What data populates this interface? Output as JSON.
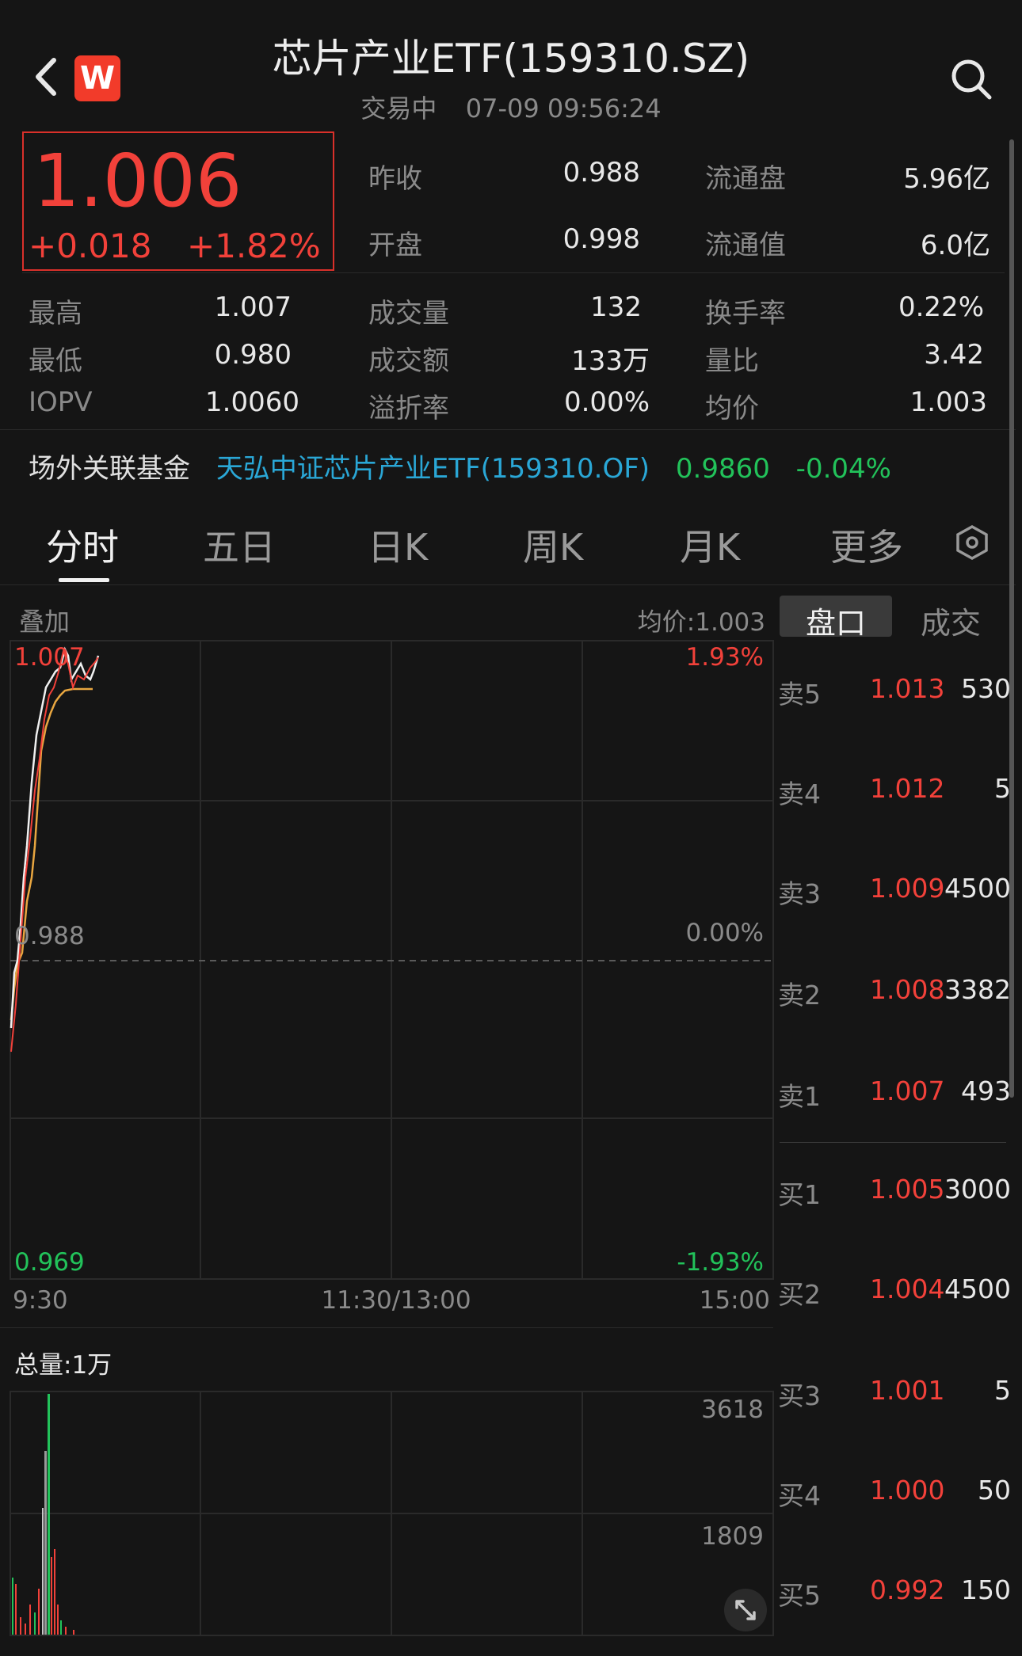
{
  "header": {
    "title": "芯片产业ETF(159310.SZ)",
    "status": "交易中",
    "datetime": "07-09 09:56:24",
    "logo_letter": "W"
  },
  "price": {
    "current": "1.006",
    "change": "+0.018",
    "change_pct": "+1.82%"
  },
  "stats_top": [
    {
      "label": "昨收",
      "value": "0.988"
    },
    {
      "label": "流通盘",
      "value": "5.96亿"
    },
    {
      "label": "开盘",
      "value": "0.998"
    },
    {
      "label": "流通值",
      "value": "6.0亿"
    }
  ],
  "stats_grid": [
    {
      "label": "最高",
      "value": "1.007"
    },
    {
      "label": "成交量",
      "value": "132"
    },
    {
      "label": "换手率",
      "value": "0.22%"
    },
    {
      "label": "最低",
      "value": "0.980"
    },
    {
      "label": "成交额",
      "value": "133万"
    },
    {
      "label": "量比",
      "value": "3.42"
    },
    {
      "label": "IOPV",
      "value": "1.0060"
    },
    {
      "label": "溢折率",
      "value": "0.00%"
    },
    {
      "label": "均价",
      "value": "1.003"
    }
  ],
  "related_fund": {
    "label": "场外关联基金",
    "name": "天弘中证芯片产业ETF(159310.OF)",
    "price": "0.9860",
    "change": "-0.04%"
  },
  "tabs": [
    "分时",
    "五日",
    "日K",
    "周K",
    "月K",
    "更多"
  ],
  "active_tab": "分时",
  "chart_header": {
    "overlay_label": "叠加",
    "avg_price": "均价:1.003"
  },
  "orderbook_tabs": [
    "盘口",
    "成交"
  ],
  "price_chart": {
    "y_high": "1.007",
    "y_mid": "0.988",
    "y_low": "0.969",
    "pct_high": "1.93%",
    "pct_mid": "0.00%",
    "pct_low": "-1.93%",
    "x_start": "9:30",
    "x_mid": "11:30/13:00",
    "x_end": "15:00"
  },
  "volume_chart": {
    "total_label": "总量:1万",
    "y_high": "3618",
    "y_mid": "1809"
  },
  "orderbook": {
    "asks": [
      {
        "label": "卖5",
        "price": "1.013",
        "volume": "530"
      },
      {
        "label": "卖4",
        "price": "1.012",
        "volume": "5"
      },
      {
        "label": "卖3",
        "price": "1.009",
        "volume": "4500"
      },
      {
        "label": "卖2",
        "price": "1.008",
        "volume": "3382"
      },
      {
        "label": "卖1",
        "price": "1.007",
        "volume": "493"
      }
    ],
    "bids": [
      {
        "label": "买1",
        "price": "1.005",
        "volume": "3000"
      },
      {
        "label": "买2",
        "price": "1.004",
        "volume": "4500"
      },
      {
        "label": "买3",
        "price": "1.001",
        "volume": "5"
      },
      {
        "label": "买4",
        "price": "1.000",
        "volume": "50"
      },
      {
        "label": "买5",
        "price": "0.992",
        "volume": "150"
      }
    ]
  },
  "colors": {
    "up": "#f2413a",
    "down": "#22c25a",
    "accent_blue": "#2aa7d6",
    "avg_line": "#e8a640",
    "background": "#151515"
  }
}
